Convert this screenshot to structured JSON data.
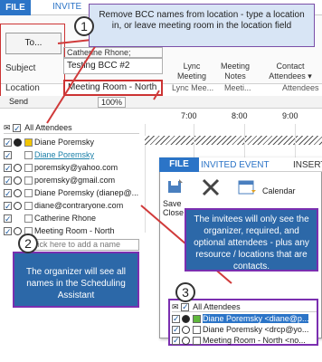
{
  "ribbon": {
    "file_tab": "FILE",
    "invit_tab": "INVITE",
    "recipient_chip": "Catherine Rhone;",
    "buttons": [
      {
        "label": "Lync\nMeeting"
      },
      {
        "label": "Meeting\nNotes"
      },
      {
        "label": "Contact\nAttendees ▾"
      }
    ],
    "group_labels": [
      "Lync Mee...",
      "Meeti...",
      "Attendees"
    ]
  },
  "form": {
    "to_label": "To...",
    "subject_label": "Subject",
    "subject_value": "Testing BCC #2",
    "location_label": "Location",
    "location_value": "Meeting Room - North"
  },
  "toolbar2": {
    "send": "Send",
    "zoom": "100%"
  },
  "schedule": {
    "hours": [
      "7:00",
      "8:00",
      "9:00"
    ],
    "header": "All Attendees",
    "attendees": [
      {
        "name": "Diane Poremsky",
        "icon": "organizer-icon",
        "color": "#222222",
        "box": "#f2c500"
      },
      {
        "name": "Diane Poremsky",
        "icon": "none",
        "color": "#1a7fa8",
        "box": "#ffffff"
      },
      {
        "name": "poremsky@yahoo.com",
        "icon": "required-icon",
        "color": "#222222",
        "box": "#ffffff"
      },
      {
        "name": "poremsky@gmail.com",
        "icon": "required-icon",
        "color": "#222222",
        "box": "#ffffff"
      },
      {
        "name": "Diane Poremsky  (dianep@...",
        "icon": "required-icon",
        "color": "#222222",
        "box": "#ffffff"
      },
      {
        "name": "diane@contraryone.com",
        "icon": "required-icon",
        "color": "#222222",
        "box": "#ffffff"
      },
      {
        "name": "Catherine Rhone",
        "icon": "none",
        "color": "#222222",
        "box": "#ffffff"
      },
      {
        "name": "Meeting Room - North",
        "icon": "required-icon",
        "color": "#222222",
        "box": "#ffffff"
      }
    ],
    "add_placeholder": "Click here to add a name"
  },
  "inner": {
    "file_tab": "FILE",
    "invited_tab": "INVITED EVENT",
    "insert_tab": "INSERT",
    "save_close": "Save\nClose",
    "calendar": "Calendar",
    "header": "All Attendees",
    "attendees": [
      {
        "name": "Diane Poremsky  <diane@p...",
        "box": "#5fb83c"
      },
      {
        "name": "Diane Poremsky  <drcp@yo...",
        "box": "#ffffff"
      },
      {
        "name": "Meeting Room - North  <no...",
        "box": "#ffffff"
      }
    ]
  },
  "callouts": {
    "c1_num": "1",
    "c1_text": "Remove BCC names from location - type a location in, or leave meeting room in the location field",
    "c2_num": "2",
    "c2_text": "The organizer will see all names in the Scheduling Assistant",
    "c3_num": "3",
    "c3_text": "The invitees will only see the organizer, required, and optional attendees - plus any resource / locations that are contacts."
  },
  "colors": {
    "accent": "#2b74c7",
    "callout_border": "#7b2fb0",
    "arrow": "#d03a3a"
  }
}
